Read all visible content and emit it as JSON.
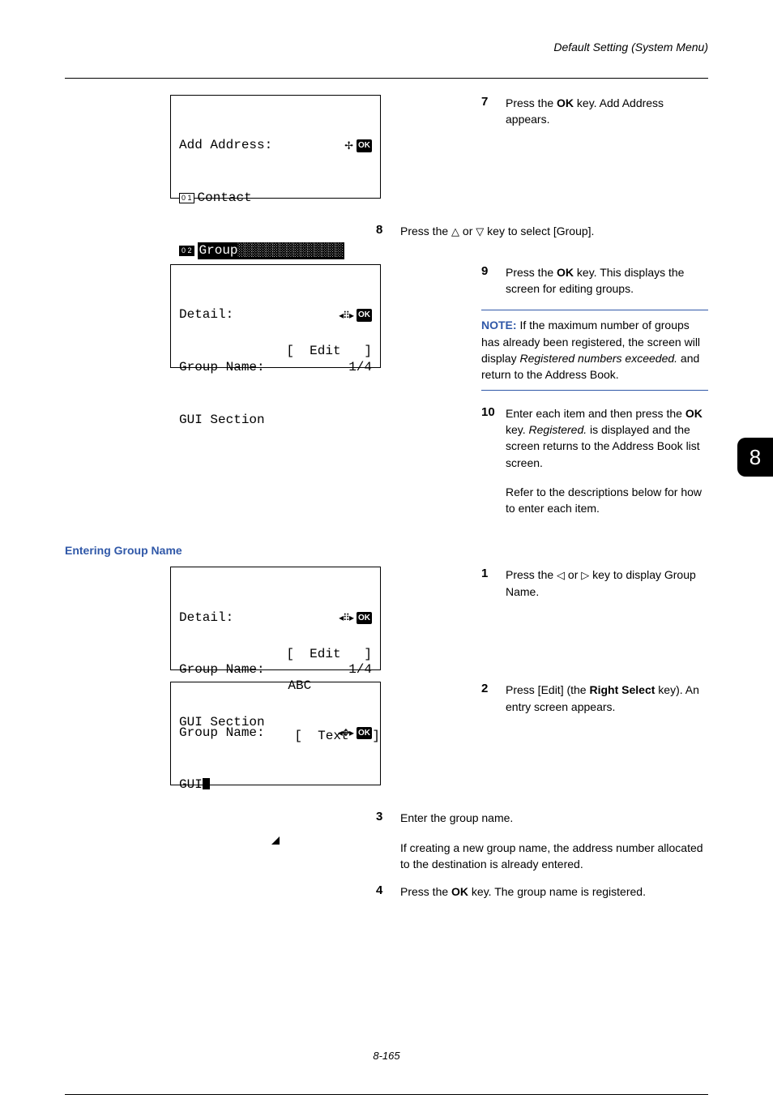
{
  "header": {
    "title": "Default Setting (System Menu)"
  },
  "chapterTab": "8",
  "footer": {
    "page": "8-165"
  },
  "lcd1": {
    "title": "Add Address:",
    "item1_num": "0 1",
    "item1_label": "Contact",
    "item2_num": "0 2",
    "item2_label": "Group",
    "ok": "OK"
  },
  "lcd2": {
    "title": "Detail:",
    "line2a": "Group Name:",
    "line2b": "1/4",
    "line3": "GUI Section",
    "button": "[  Edit   ]",
    "ok": "OK"
  },
  "lcd3": {
    "title": "Detail:",
    "line2a": "Group Name:",
    "line2b": "1/4",
    "line3": "GUI Section",
    "button": "[  Edit   ]",
    "ok": "OK"
  },
  "lcd4": {
    "title": "Group Name:",
    "value": "GUI",
    "abc": " ABC",
    "text": "[  Text   ]",
    "ok": "OK"
  },
  "steps": {
    "s7": {
      "num": "7",
      "t1": "Press the ",
      "ok": "OK",
      "t2": " key. Add Address appears."
    },
    "s8": {
      "num": "8",
      "t1": "Press the ",
      "t2": " or ",
      "t3": " key to select [Group]."
    },
    "s9": {
      "num": "9",
      "t1": "Press the ",
      "ok": "OK",
      "t2": " key. This displays the screen for editing groups."
    },
    "note": {
      "label": "NOTE:",
      "t1": " If the maximum number of groups has already been registered, the screen will display ",
      "i1": "Registered numbers exceeded.",
      "t2": " and return to the Address Book."
    },
    "s10": {
      "num": "10",
      "t1": "Enter each item and then press the ",
      "ok": "OK",
      "t2": " key. ",
      "i1": "Registered.",
      "t3": " is displayed and the screen returns to the Address Book list screen.",
      "p2": "Refer to the descriptions below for how to enter each item."
    },
    "s1": {
      "num": "1",
      "t1": "Press the ",
      "t2": " or ",
      "t3": " key to display Group Name."
    },
    "s2": {
      "num": "2",
      "t1": "Press [Edit] (the ",
      "b1": "Right Select",
      "t2": " key). An entry screen appears."
    },
    "s3": {
      "num": "3",
      "t1": "Enter the group name.",
      "p2": "If creating a new group name, the address number allocated to the destination is already entered."
    },
    "s4": {
      "num": "4",
      "t1": " Press the ",
      "ok": "OK",
      "t2": " key. The group name is registered."
    }
  },
  "headings": {
    "groupName": "Entering Group Name"
  }
}
